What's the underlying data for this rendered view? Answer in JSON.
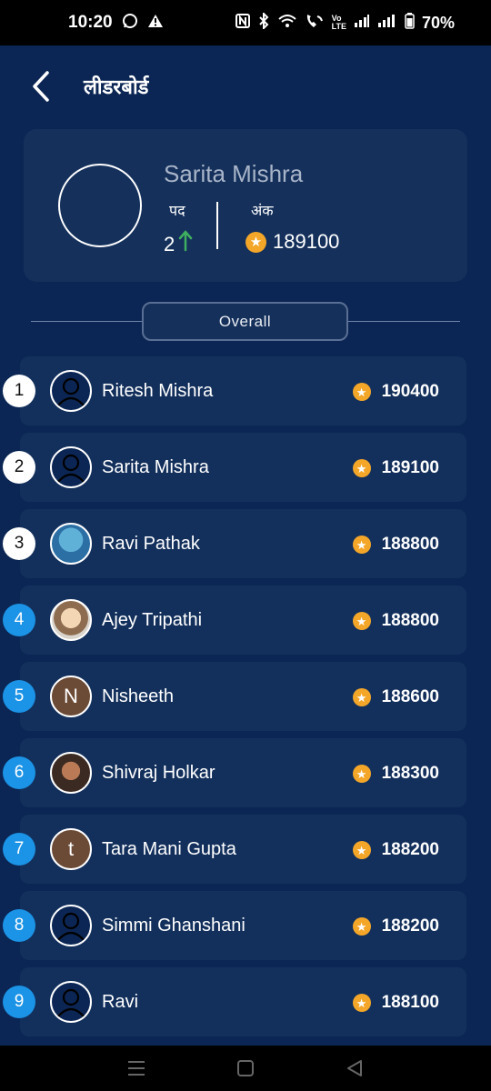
{
  "status_bar": {
    "time": "10:20",
    "battery": "70%"
  },
  "header": {
    "title": "लीडरबोर्ड"
  },
  "profile": {
    "name": "Sarita Mishra",
    "rank_label": "पद",
    "rank_value": "2",
    "points_label": "अंक",
    "points_value": "189100"
  },
  "filter": {
    "label": "Overall"
  },
  "leaderboard": {
    "rows": [
      {
        "rank": "1",
        "name": "Ritesh Mishra",
        "points": "190400",
        "avatar": "person-icon"
      },
      {
        "rank": "2",
        "name": "Sarita Mishra",
        "points": "189100",
        "avatar": "person-icon"
      },
      {
        "rank": "3",
        "name": "Ravi Pathak",
        "points": "188800",
        "avatar": "photo"
      },
      {
        "rank": "4",
        "name": "Ajey Tripathi",
        "points": "188800",
        "avatar": "photo"
      },
      {
        "rank": "5",
        "name": "Nisheeth",
        "points": "188600",
        "avatar": "N"
      },
      {
        "rank": "6",
        "name": "Shivraj Holkar",
        "points": "188300",
        "avatar": "photo"
      },
      {
        "rank": "7",
        "name": "Tara Mani Gupta",
        "points": "188200",
        "avatar": "t"
      },
      {
        "rank": "8",
        "name": "Simmi Ghanshani",
        "points": "188200",
        "avatar": "person-icon"
      },
      {
        "rank": "9",
        "name": "Ravi",
        "points": "188100",
        "avatar": "person-icon"
      }
    ]
  },
  "colors": {
    "background": "#0b2654",
    "card": "#13305c",
    "rank_badge_blue": "#1b93e6",
    "coin": "#f4a629",
    "up_arrow": "#3fae5f"
  }
}
